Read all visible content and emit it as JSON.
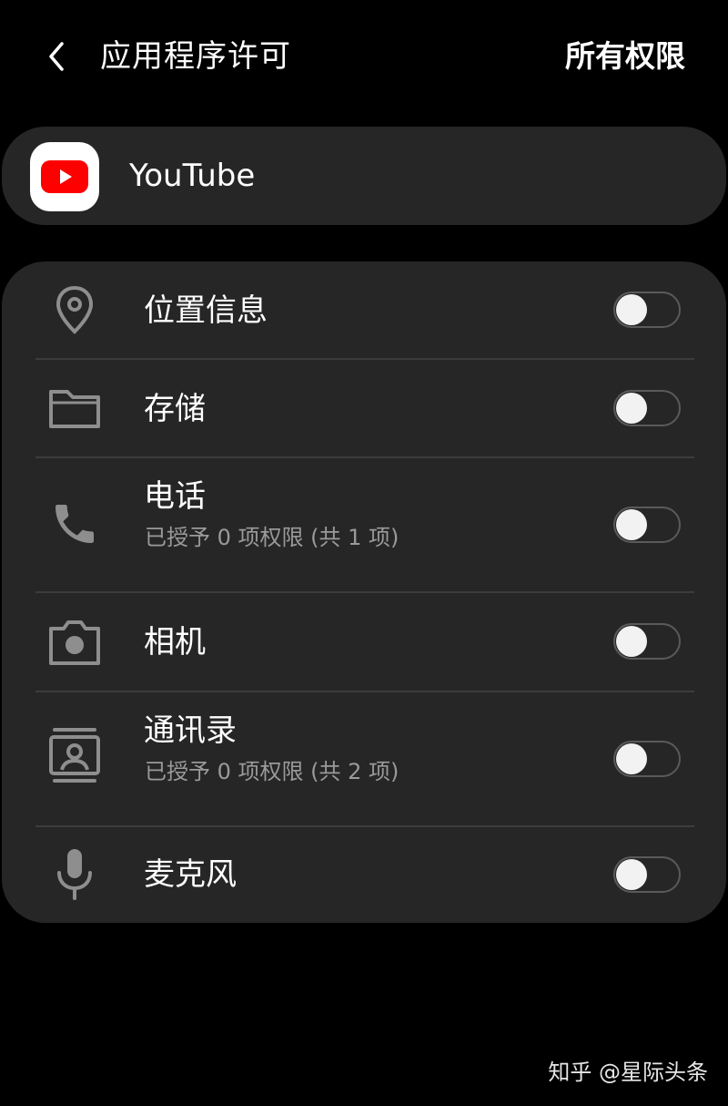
{
  "header": {
    "title": "应用程序许可",
    "all_permissions_label": "所有权限",
    "back_icon": "chevron-left-icon"
  },
  "app": {
    "name": "YouTube",
    "icon": "youtube-logo",
    "brand_color": "#ff0000"
  },
  "permissions": [
    {
      "label": "位置信息",
      "subtitle": "",
      "icon": "location-pin-icon",
      "enabled": false
    },
    {
      "label": "存储",
      "subtitle": "",
      "icon": "folder-icon",
      "enabled": false
    },
    {
      "label": "电话",
      "subtitle": "已授予 0 项权限 (共 1 项)",
      "icon": "phone-icon",
      "enabled": false
    },
    {
      "label": "相机",
      "subtitle": "",
      "icon": "camera-icon",
      "enabled": false
    },
    {
      "label": "通讯录",
      "subtitle": "已授予 0 项权限 (共 2 项)",
      "icon": "contacts-icon",
      "enabled": false
    },
    {
      "label": "麦克风",
      "subtitle": "",
      "icon": "microphone-icon",
      "enabled": false
    }
  ],
  "watermark": "知乎 @星际头条",
  "colors": {
    "background": "#000000",
    "card": "#262626",
    "icon": "#8e8e8e",
    "subtitle": "#9a9a9a"
  }
}
